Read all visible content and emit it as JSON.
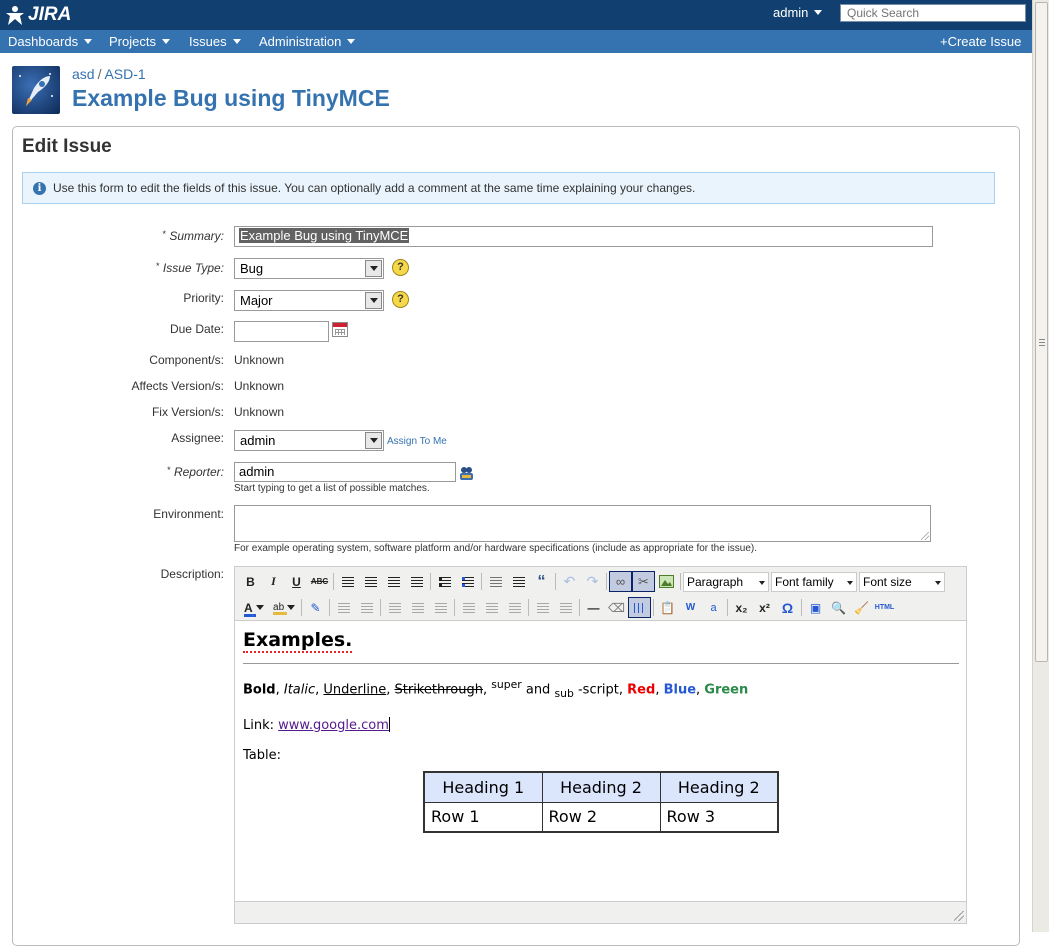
{
  "header": {
    "logo_text": "JIRA",
    "user": "admin",
    "search_placeholder": "Quick Search"
  },
  "nav": {
    "items": [
      {
        "label": "Dashboards"
      },
      {
        "label": "Projects"
      },
      {
        "label": "Issues"
      },
      {
        "label": "Administration"
      }
    ],
    "create_issue": "Create Issue"
  },
  "page": {
    "breadcrumb_project": "asd",
    "breadcrumb_sep": "/",
    "breadcrumb_issue": "ASD-1",
    "title": "Example Bug using TinyMCE"
  },
  "panel": {
    "title": "Edit Issue",
    "info": "Use this form to edit the fields of this issue. You can optionally add a comment at the same time explaining your changes."
  },
  "form": {
    "summary_label": "Summary:",
    "summary_value": "Example Bug using TinyMCE",
    "issue_type_label": "Issue Type:",
    "issue_type_value": "Bug",
    "priority_label": "Priority:",
    "priority_value": "Major",
    "due_date_label": "Due Date:",
    "due_date_value": "",
    "components_label": "Component/s:",
    "components_value": "Unknown",
    "affects_label": "Affects Version/s:",
    "affects_value": "Unknown",
    "fix_label": "Fix Version/s:",
    "fix_value": "Unknown",
    "assignee_label": "Assignee:",
    "assignee_value": "admin",
    "assign_to_me": "Assign To Me",
    "reporter_label": "Reporter:",
    "reporter_value": "admin",
    "reporter_hint": "Start typing to get a list of possible matches.",
    "environment_label": "Environment:",
    "environment_hint": "For example operating system, software platform and/or hardware specifications (include as appropriate for the issue).",
    "description_label": "Description:",
    "required_mark": "*"
  },
  "editor": {
    "toolbar": {
      "bold": "B",
      "italic": "I",
      "underline": "U",
      "strike": "ABC",
      "blockquote": "“",
      "format_select": "Paragraph",
      "font_family_select": "Font family",
      "font_size_select": "Font size",
      "subscript": "x₂",
      "superscript": "x²",
      "charmap": "Ω",
      "html": "HTML",
      "forecolor": "A",
      "backcolor": "ab"
    },
    "content": {
      "heading": "Examples.",
      "bold": "Bold",
      "sep1": ", ",
      "italic": "Italic",
      "sep2": ", ",
      "underline": "Underline",
      "sep3": ", ",
      "strikethrough": "Strikethrough",
      "sep4": ", ",
      "super": "super",
      "and": " and ",
      "sub": "sub",
      "script": " -script, ",
      "red": "Red",
      "sep5": ", ",
      "blue": "Blue",
      "sep6": ", ",
      "green": "Green",
      "link_label": "Link: ",
      "link_text": "www.google.com",
      "table_label": "Table:",
      "table": {
        "headers": [
          "Heading 1",
          "Heading 2",
          "Heading 2"
        ],
        "rows": [
          [
            "Row 1",
            "Row 2",
            "Row 3"
          ]
        ]
      }
    }
  },
  "colors": {
    "topbar": "#114070",
    "navbar": "#3572b0",
    "link": "#3572b0",
    "red": "#e00000",
    "blue": "#2558d4",
    "green": "#2a8a4a"
  }
}
